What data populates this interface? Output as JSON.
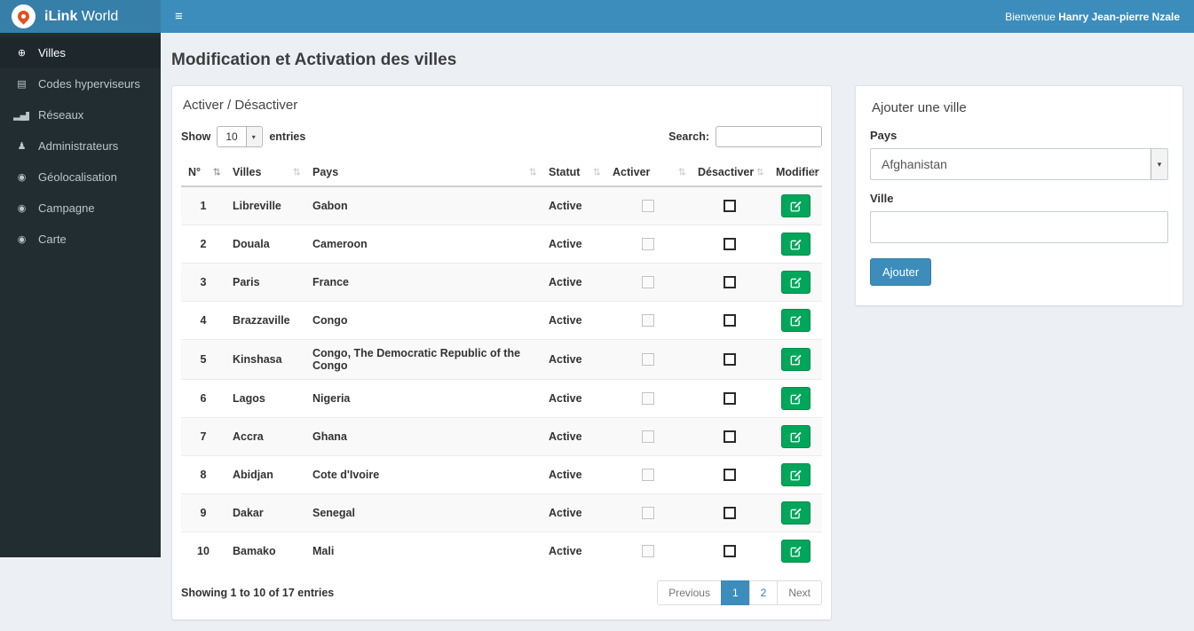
{
  "brand": {
    "bold": "iLink",
    "regular": "World"
  },
  "header": {
    "menu_icon": "≡",
    "welcome_prefix": "Bienvenue",
    "welcome_name": "Hanry Jean-pierre Nzale"
  },
  "sidebar": {
    "items": [
      {
        "label": "Villes",
        "icon": "globe-icon",
        "glyph": "⊕",
        "active": true
      },
      {
        "label": "Codes hyperviseurs",
        "icon": "list-icon",
        "glyph": "▤",
        "active": false
      },
      {
        "label": "Réseaux",
        "icon": "signal-icon",
        "glyph": "▂▄▆",
        "active": false
      },
      {
        "label": "Administrateurs",
        "icon": "user-icon",
        "glyph": "♟",
        "active": false
      },
      {
        "label": "Géolocalisation",
        "icon": "map-marker-icon",
        "glyph": "◉",
        "active": false
      },
      {
        "label": "Campagne",
        "icon": "map-marker-icon",
        "glyph": "◉",
        "active": false
      },
      {
        "label": "Carte",
        "icon": "map-marker-icon",
        "glyph": "◉",
        "active": false
      }
    ]
  },
  "page": {
    "title": "Modification et Activation des villes"
  },
  "ui": {
    "sort_glyph": "⇅",
    "chevron_glyph": "▾"
  },
  "table_panel": {
    "title": "Activer / Désactiver",
    "length_control": {
      "show_label": "Show",
      "value": "10",
      "entries_label": "entries"
    },
    "search": {
      "label": "Search:",
      "value": ""
    },
    "columns": [
      {
        "label": "N°",
        "sorted": true
      },
      {
        "label": "Villes",
        "sorted": false
      },
      {
        "label": "Pays",
        "sorted": false
      },
      {
        "label": "Statut",
        "sorted": false
      },
      {
        "label": "Activer",
        "sorted": false
      },
      {
        "label": "Désactiver",
        "sorted": false
      },
      {
        "label": "Modifier",
        "sorted": false
      }
    ],
    "rows": [
      {
        "num": "1",
        "ville": "Libreville",
        "pays": "Gabon",
        "statut": "Active"
      },
      {
        "num": "2",
        "ville": "Douala",
        "pays": "Cameroon",
        "statut": "Active"
      },
      {
        "num": "3",
        "ville": "Paris",
        "pays": "France",
        "statut": "Active"
      },
      {
        "num": "4",
        "ville": "Brazzaville",
        "pays": "Congo",
        "statut": "Active"
      },
      {
        "num": "5",
        "ville": "Kinshasa",
        "pays": "Congo, The Democratic Republic of the Congo",
        "statut": "Active"
      },
      {
        "num": "6",
        "ville": "Lagos",
        "pays": "Nigeria",
        "statut": "Active"
      },
      {
        "num": "7",
        "ville": "Accra",
        "pays": "Ghana",
        "statut": "Active"
      },
      {
        "num": "8",
        "ville": "Abidjan",
        "pays": "Cote d'Ivoire",
        "statut": "Active"
      },
      {
        "num": "9",
        "ville": "Dakar",
        "pays": "Senegal",
        "statut": "Active"
      },
      {
        "num": "10",
        "ville": "Bamako",
        "pays": "Mali",
        "statut": "Active"
      }
    ],
    "footer": {
      "info": "Showing 1 to 10 of 17 entries",
      "pagination": {
        "previous": "Previous",
        "pages": [
          "1",
          "2"
        ],
        "active_page": "1",
        "next": "Next"
      }
    }
  },
  "add_panel": {
    "title": "Ajouter une ville",
    "country_label": "Pays",
    "country_value": "Afghanistan",
    "city_label": "Ville",
    "city_value": "",
    "submit_label": "Ajouter"
  },
  "colors": {
    "navbar": "#3c8dbc",
    "logo_bg": "#367fa9",
    "sidebar_bg": "#222d32",
    "sidebar_active_bg": "#1e282c",
    "success_green": "#00a65a",
    "content_bg": "#ecf0f5"
  }
}
